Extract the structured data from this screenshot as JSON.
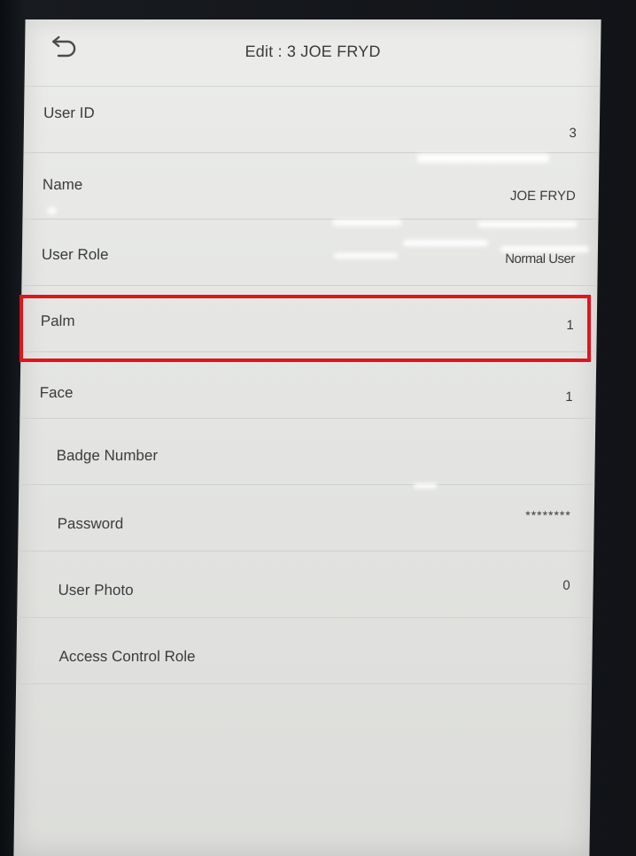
{
  "header": {
    "back_icon": "back-arrow-icon",
    "title": "Edit : 3 JOE FRYD"
  },
  "fields": [
    {
      "key": "user_id",
      "label": "User ID",
      "value": "3"
    },
    {
      "key": "name",
      "label": "Name",
      "value": "JOE FRYD"
    },
    {
      "key": "user_role",
      "label": "User Role",
      "value": "Normal User"
    },
    {
      "key": "palm",
      "label": "Palm",
      "value": "1"
    },
    {
      "key": "face",
      "label": "Face",
      "value": "1"
    },
    {
      "key": "badge_number",
      "label": "Badge Number",
      "value": ""
    },
    {
      "key": "password",
      "label": "Password",
      "value": "********"
    },
    {
      "key": "user_photo",
      "label": "User Photo",
      "value": "0"
    },
    {
      "key": "access_control_role",
      "label": "Access Control Role",
      "value": ""
    }
  ],
  "highlight": {
    "target": "palm",
    "color": "#e0151b"
  }
}
